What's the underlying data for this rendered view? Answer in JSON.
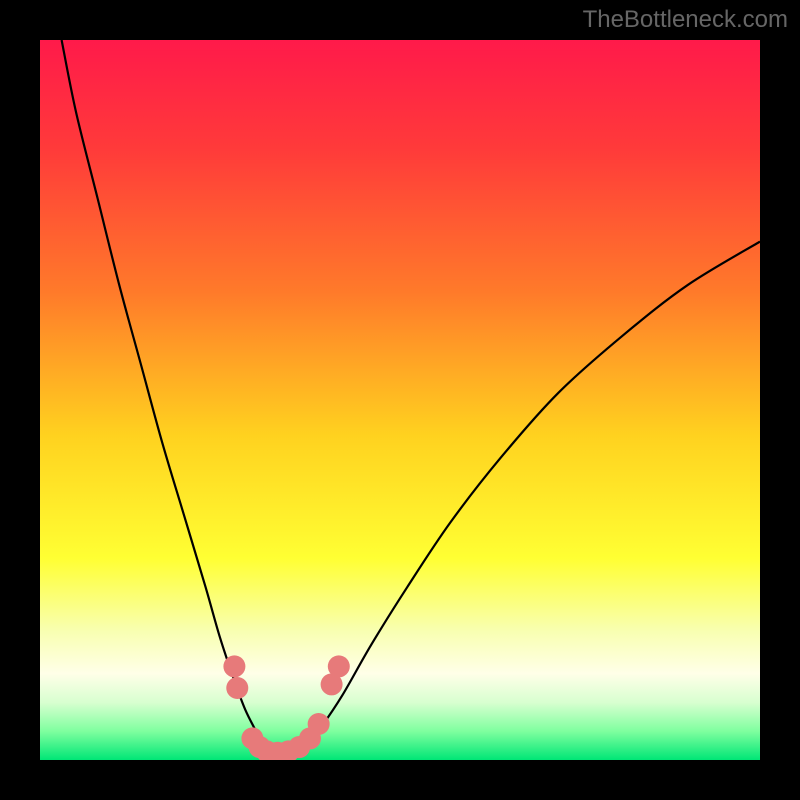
{
  "watermark": "TheBottleneck.com",
  "chart_data": {
    "type": "line",
    "title": "",
    "xlabel": "",
    "ylabel": "",
    "xlim": [
      0,
      100
    ],
    "ylim": [
      0,
      100
    ],
    "background_gradient": {
      "stops": [
        {
          "offset": 0.0,
          "color": "#ff1a4a"
        },
        {
          "offset": 0.15,
          "color": "#ff3a3a"
        },
        {
          "offset": 0.35,
          "color": "#ff7a2a"
        },
        {
          "offset": 0.55,
          "color": "#ffd21f"
        },
        {
          "offset": 0.72,
          "color": "#ffff33"
        },
        {
          "offset": 0.82,
          "color": "#f8ffb0"
        },
        {
          "offset": 0.88,
          "color": "#ffffe8"
        },
        {
          "offset": 0.92,
          "color": "#d8ffd0"
        },
        {
          "offset": 0.96,
          "color": "#7fff9f"
        },
        {
          "offset": 1.0,
          "color": "#00e676"
        }
      ]
    },
    "series": [
      {
        "name": "bottleneck-curve",
        "color": "#000000",
        "width": 2.2,
        "x": [
          3,
          5,
          8,
          11,
          14,
          17,
          20,
          23,
          25,
          27,
          28.5,
          30,
          31,
          32,
          33,
          34,
          35,
          37,
          39,
          42,
          46,
          51,
          57,
          64,
          72,
          81,
          90,
          100
        ],
        "y": [
          100,
          90,
          78,
          66,
          55,
          44,
          34,
          24,
          17,
          11,
          7,
          4,
          2,
          1.2,
          1,
          1,
          1.2,
          2,
          4.5,
          9,
          16,
          24,
          33,
          42,
          51,
          59,
          66,
          72
        ]
      }
    ],
    "markers": {
      "name": "highlight-dots",
      "color": "#e77a7a",
      "radius": 11,
      "points": [
        {
          "x": 27.0,
          "y": 13.0
        },
        {
          "x": 27.4,
          "y": 10.0
        },
        {
          "x": 29.5,
          "y": 3.0
        },
        {
          "x": 30.5,
          "y": 1.8
        },
        {
          "x": 31.5,
          "y": 1.2
        },
        {
          "x": 33.0,
          "y": 1.0
        },
        {
          "x": 34.5,
          "y": 1.2
        },
        {
          "x": 36.0,
          "y": 1.8
        },
        {
          "x": 37.5,
          "y": 3.0
        },
        {
          "x": 38.7,
          "y": 5.0
        },
        {
          "x": 40.5,
          "y": 10.5
        },
        {
          "x": 41.5,
          "y": 13.0
        }
      ]
    }
  }
}
